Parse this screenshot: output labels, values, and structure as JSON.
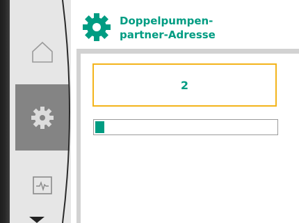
{
  "header": {
    "title_line1": "Doppelpumpen-",
    "title_line2": "partner-Adresse",
    "icon": "gear-icon"
  },
  "sidebar": {
    "items": [
      {
        "name": "home",
        "icon": "home-icon",
        "selected": false
      },
      {
        "name": "settings",
        "icon": "gear-icon",
        "selected": true
      },
      {
        "name": "monitor",
        "icon": "pulse-monitor-icon",
        "selected": false
      }
    ],
    "more_indicator": "chevron-down-icon"
  },
  "main": {
    "value": "2",
    "progress_fraction": 0.05
  },
  "colors": {
    "accent": "#009C82",
    "focus_border": "#F3B41B",
    "sidebar_bg": "#E6E6E6",
    "sidebar_selected": "#848484",
    "panel_frame": "#D2D2D2"
  }
}
